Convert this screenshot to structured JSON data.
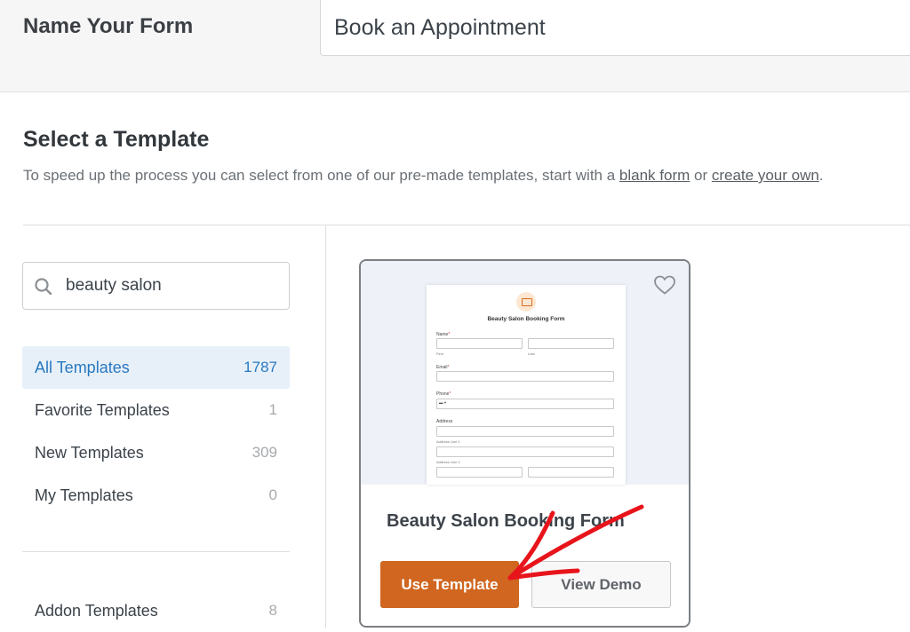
{
  "header": {
    "name_label": "Name Your Form",
    "form_name_value": "Book an Appointment"
  },
  "section": {
    "title": "Select a Template",
    "description_prefix": "To speed up the process you can select from one of our pre-made templates, start with a ",
    "blank_form_link": "blank form",
    "description_or": " or ",
    "create_own_link": "create your own",
    "description_suffix": "."
  },
  "search": {
    "value": "beauty salon"
  },
  "categories": [
    {
      "label": "All Templates",
      "count": "1787",
      "active": true
    },
    {
      "label": "Favorite Templates",
      "count": "1"
    },
    {
      "label": "New Templates",
      "count": "309"
    },
    {
      "label": "My Templates",
      "count": "0"
    },
    {
      "label": "Addon Templates",
      "count": "8"
    }
  ],
  "template_card": {
    "title": "Beauty Salon Booking Form",
    "use_button": "Use Template",
    "demo_button": "View Demo",
    "preview": {
      "title": "Beauty Salon Booking Form",
      "name_label": "Name",
      "first": "First",
      "last": "Last",
      "email_label": "Email",
      "phone_label": "Phone",
      "address_label": "Address",
      "address_line1": "Address Line 1",
      "address_line2": "Address Line 2"
    }
  },
  "colors": {
    "accent_orange": "#d0661f",
    "active_blue": "#2878c0",
    "annotation_red": "#e8141c"
  }
}
